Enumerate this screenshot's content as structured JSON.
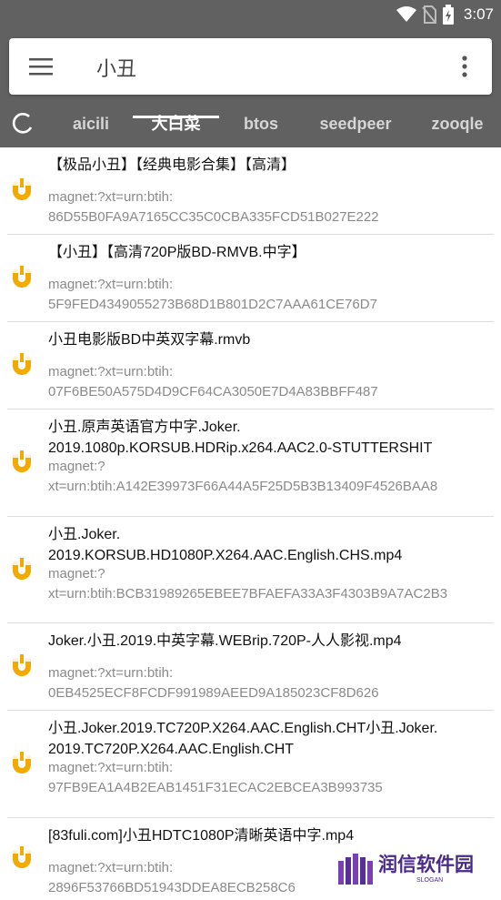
{
  "status_bar": {
    "time": "3:07",
    "icons": [
      "wifi-icon",
      "no-sim-icon",
      "battery-charging-icon"
    ]
  },
  "search": {
    "query": "小丑",
    "menu_icon": "hamburger-menu-icon",
    "more_icon": "more-vert-icon"
  },
  "tabs": {
    "refresh_icon": "refresh-icon",
    "items": [
      {
        "label": "aicili"
      },
      {
        "label": "大白菜",
        "active": true
      },
      {
        "label": "btos"
      },
      {
        "label": "seedpeer"
      },
      {
        "label": "zooqle"
      }
    ]
  },
  "results": [
    {
      "title": "【极品小丑】【经典电影合集】【高清】",
      "link": "magnet:?xt=urn:btih:\n86D55B0FA9A7165CC35C0CBA335FCD51B027E222"
    },
    {
      "title": "【小丑】【高清720P版BD-RMVB.中字】",
      "link": "magnet:?xt=urn:btih:\n5F9FED4349055273B68D1B801D2C7AAA61CE76D7"
    },
    {
      "title": "小丑电影版BD中英双字幕.rmvb",
      "link": "magnet:?xt=urn:btih:\n07F6BE50A575D4D9CF64CA3050E7D4A83BBFF487"
    },
    {
      "title": "小丑.原声英语官方中字.Joker.\n2019.1080p.KORSUB.HDRip.x264.AAC2.0-STUTTERSHIT",
      "link": "magnet:?\nxt=urn:btih:A142E39973F66A44A5F25D5B3B13409F4526BAA8"
    },
    {
      "title": "小丑.Joker.\n2019.KORSUB.HD1080P.X264.AAC.English.CHS.mp4",
      "link": "magnet:?\nxt=urn:btih:BCB31989265EBEE7BFAEFA33A3F4303B9A7AC2B3"
    },
    {
      "title": "Joker.小丑.2019.中英字幕.WEBrip.720P-人人影视.mp4",
      "link": "magnet:?xt=urn:btih:\n0EB4525ECF8FCDF991989AEED9A185023CF8D626"
    },
    {
      "title": "小丑.Joker.2019.TC720P.X264.AAC.English.CHT小丑.Joker.\n2019.TC720P.X264.AAC.English.CHT",
      "link": "magnet:?xt=urn:btih:\n97FB9EA1A4B2EAB1451F31ECAC2EBCEA3B993735"
    },
    {
      "title": "[83fuli.com]小丑HDTC1080P清晰英语中字.mp4",
      "link": "magnet:?xt=urn:btih:\n2896F53766BD51943DDEA8ECB258C6"
    }
  ],
  "watermark": {
    "name": "润信软件园",
    "slogan": "SLOGAN"
  },
  "colors": {
    "appbar": "#616161",
    "magnet": "#f2a900",
    "watermark": "#4b2a8a"
  }
}
